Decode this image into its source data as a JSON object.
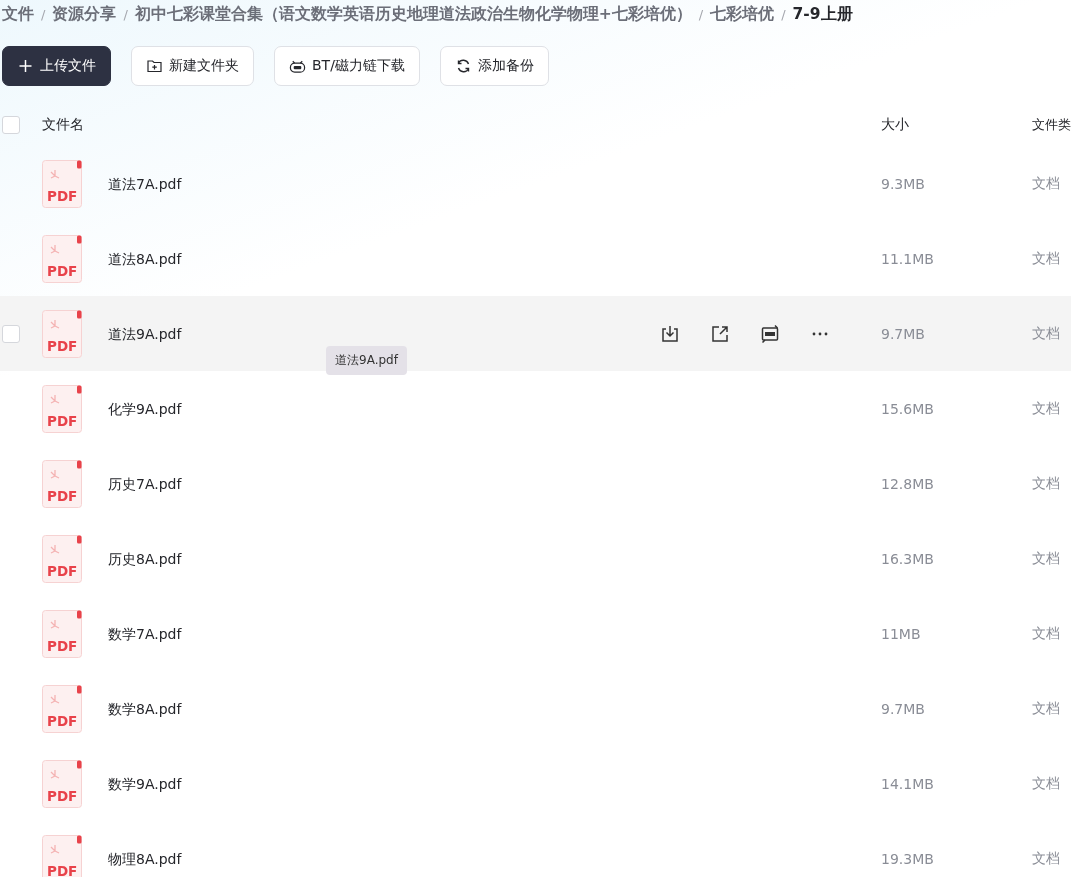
{
  "breadcrumb": [
    {
      "label": "文件",
      "current": false
    },
    {
      "separator": "/",
      "label": "资源分享",
      "current": false
    },
    {
      "separator": "/",
      "label": "初中七彩课堂合集（语文数学英语历史地理道法政治生物化学物理+七彩培优）",
      "current": false
    },
    {
      "separator": "/",
      "label": "七彩培优",
      "current": false
    },
    {
      "separator": "/",
      "label": "7-9上册",
      "current": true
    }
  ],
  "toolbar": [
    {
      "kind": "upload",
      "label": "上传文件",
      "primary": true
    },
    {
      "kind": "folder",
      "label": "新建文件夹",
      "primary": false
    },
    {
      "kind": "bt",
      "label": "BT/磁力链下载",
      "primary": false
    },
    {
      "kind": "backup",
      "label": "添加备份",
      "primary": false
    }
  ],
  "table": {
    "select_all_checked": false,
    "columns": [
      "文件名",
      "大小",
      "文件类"
    ],
    "rows": [
      {
        "icon_text": "PDF",
        "name": "道法7A.pdf",
        "size": "9.3MB",
        "type": "文档",
        "hovered": false
      },
      {
        "icon_text": "PDF",
        "name": "道法8A.pdf",
        "size": "11.1MB",
        "type": "文档",
        "hovered": false
      },
      {
        "icon_text": "PDF",
        "name": "道法9A.pdf",
        "size": "9.7MB",
        "type": "文档",
        "hovered": true,
        "tooltip": "道法9A.pdf"
      },
      {
        "icon_text": "PDF",
        "name": "化学9A.pdf",
        "size": "15.6MB",
        "type": "文档",
        "hovered": false
      },
      {
        "icon_text": "PDF",
        "name": "历史7A.pdf",
        "size": "12.8MB",
        "type": "文档",
        "hovered": false
      },
      {
        "icon_text": "PDF",
        "name": "历史8A.pdf",
        "size": "16.3MB",
        "type": "文档",
        "hovered": false
      },
      {
        "icon_text": "PDF",
        "name": "数学7A.pdf",
        "size": "11MB",
        "type": "文档",
        "hovered": false
      },
      {
        "icon_text": "PDF",
        "name": "数学8A.pdf",
        "size": "9.7MB",
        "type": "文档",
        "hovered": false
      },
      {
        "icon_text": "PDF",
        "name": "数学9A.pdf",
        "size": "14.1MB",
        "type": "文档",
        "hovered": false
      },
      {
        "icon_text": "PDF",
        "name": "物理8A.pdf",
        "size": "19.3MB",
        "type": "文档",
        "hovered": false
      }
    ]
  }
}
